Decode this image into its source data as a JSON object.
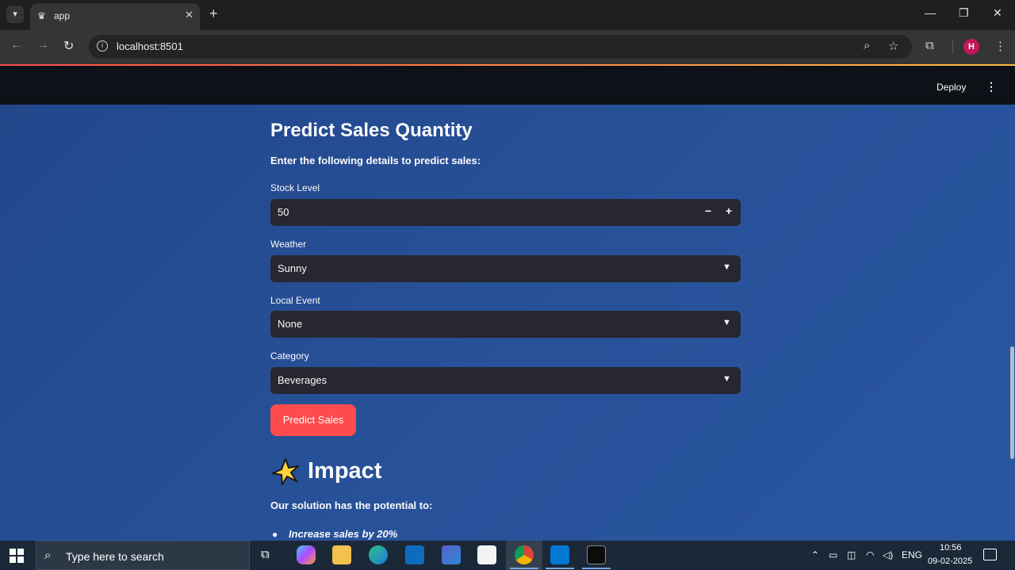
{
  "browser": {
    "tab_title": "app",
    "url": "localhost:8501",
    "profile_initial": "H"
  },
  "header": {
    "deploy_label": "Deploy",
    "accent_colors": [
      "#ff4b4b",
      "#ffbd45"
    ]
  },
  "form": {
    "title": "Predict Sales Quantity",
    "instructions": "Enter the following details to predict sales:",
    "stock_level": {
      "label": "Stock Level",
      "value": "50"
    },
    "weather": {
      "label": "Weather",
      "value": "Sunny"
    },
    "local_event": {
      "label": "Local Event",
      "value": "None"
    },
    "category": {
      "label": "Category",
      "value": "Beverages"
    },
    "submit_label": "Predict Sales",
    "submit_color": "#ff4b4b"
  },
  "impact": {
    "title": "Impact",
    "intro": "Our solution has the potential to:",
    "bullets": [
      "Increase sales by 20%"
    ]
  },
  "taskbar": {
    "search_placeholder": "Type here to search",
    "language": "ENG",
    "time": "10:56",
    "date": "09-02-2025",
    "apps": [
      "task-view-icon",
      "copilot-icon",
      "file-explorer-icon",
      "edge-icon",
      "outlook-icon",
      "dev-home-icon",
      "microsoft-store-icon",
      "chrome-icon",
      "vscode-icon",
      "terminal-icon"
    ]
  }
}
